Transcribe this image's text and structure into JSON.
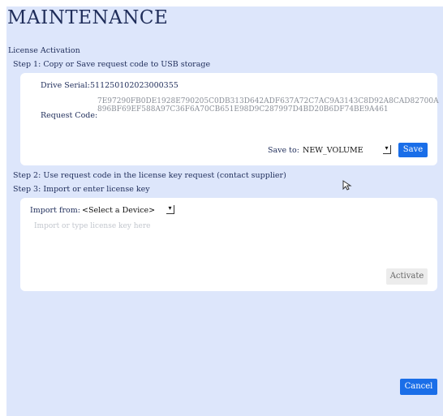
{
  "title": "MAINTENANCE",
  "license_activation_label": "License Activation",
  "step1": "Step 1: Copy or Save request code to USB storage",
  "drive_serial_label": "Drive Serial:",
  "drive_serial_value": "511250102023000355",
  "request_code_label": "Request Code:",
  "request_code_line1": "7E97290FB0DE1928E790205C0DB313D642ADF637A72C7AC9A3143C8D92A8CAD82700A",
  "request_code_line2": "896BF69EF588A97C36F6A70CB651E98D9C287997D4BD20B6DF74BE9A461",
  "save_to_label": "Save to:",
  "save_to_value": "NEW_VOLUME",
  "save_button": "Save",
  "step2": "Step 2: Use request code in the license key request (contact supplier)",
  "step3": "Step 3: Import or enter license key",
  "import_from_label": "Import from:",
  "import_from_value": "<Select a Device>",
  "license_placeholder": "Import or type license key here",
  "activate_button": "Activate",
  "cancel_button": "Cancel",
  "colors": {
    "accent": "#1a6ee8",
    "panel": "#dde6fb",
    "card": "#ffffff"
  },
  "icons": [
    "dropdown-arrow-icon",
    "mouse-pointer-icon"
  ]
}
